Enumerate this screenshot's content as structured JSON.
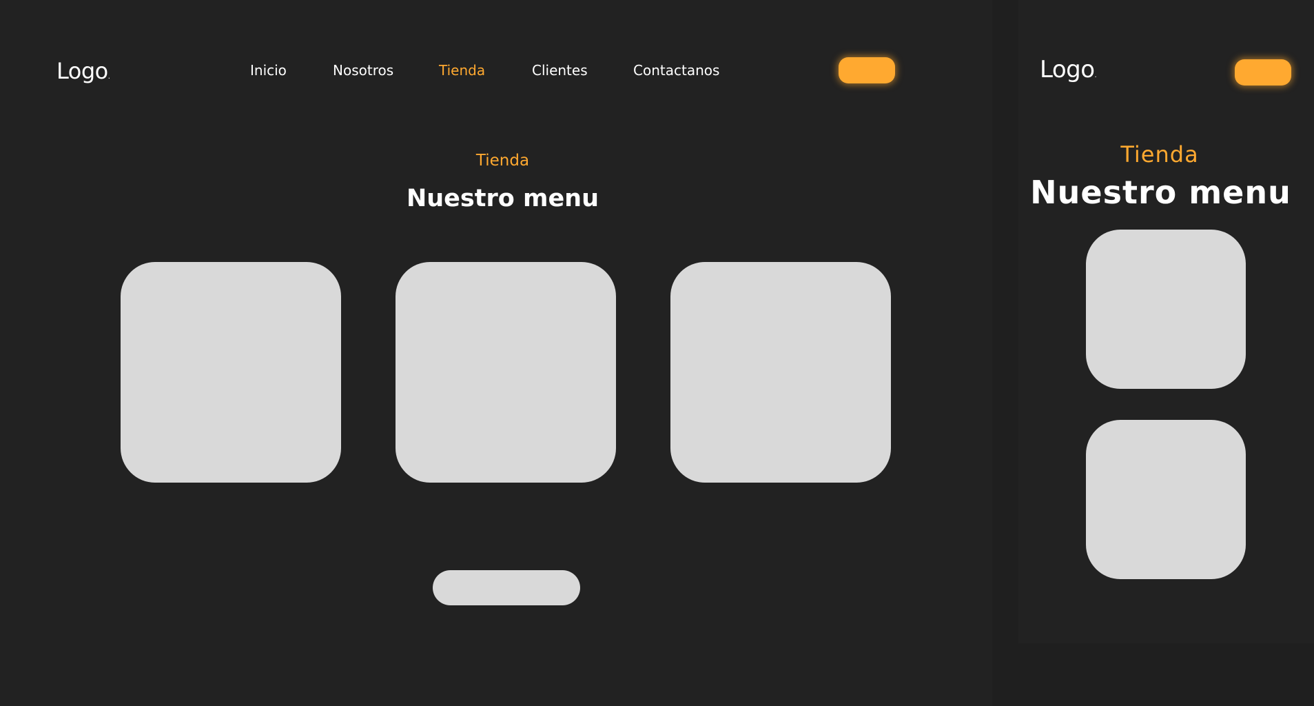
{
  "desktop": {
    "logo": "Logo",
    "logo_dot": ".",
    "nav": [
      {
        "label": "Inicio",
        "active": false
      },
      {
        "label": "Nosotros",
        "active": false
      },
      {
        "label": "Tienda",
        "active": true
      },
      {
        "label": "Clientes",
        "active": false
      },
      {
        "label": "Contactanos",
        "active": false
      }
    ],
    "section_label": "Tienda",
    "section_title": "Nuestro menu",
    "cards": [
      "",
      "",
      ""
    ],
    "more_button_label": ""
  },
  "mobile": {
    "logo": "Logo",
    "logo_dot": ".",
    "section_label": "Tienda",
    "section_title": "Nuestro menu",
    "cards": [
      "",
      ""
    ]
  },
  "colors": {
    "background": "#222222",
    "accent": "#FFA930",
    "card": "#D9D9D9",
    "text": "#FFFFFF"
  }
}
